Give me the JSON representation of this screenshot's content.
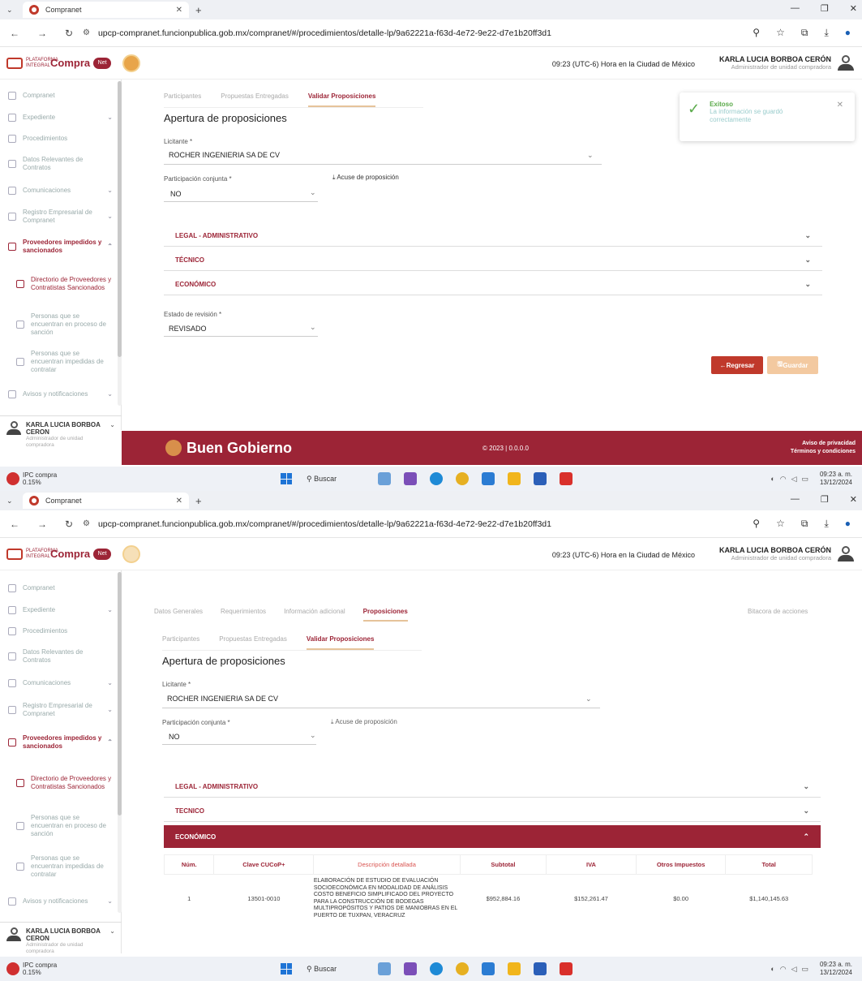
{
  "browser": {
    "tab_title_1": "Compranet",
    "tab_title_2": "Compranet",
    "url_1": "upcp-compranet.funcionpublica.gob.mx/compranet/#/procedimientos/detalle-lp/9a62221a-f63d-4e72-9e22-d7e1b20ff3d1",
    "url_2": "upcp-compranet.funcionpublica.gob.mx/compranet/#/procedimientos/detalle-lp/9a62221a-f63d-4e72-9e22-d7e1b20ff3d1"
  },
  "header": {
    "brand": "Compra",
    "brand_plus": "Net",
    "plataforma": "PLATAFORMA INTEGRAL",
    "hora": "09:23 (UTC-6) Hora en la Ciudad de México",
    "user_name": "KARLA LUCIA BORBOA CERÓN",
    "user_role": "Administrador de unidad compradora"
  },
  "sidebar": {
    "items": [
      {
        "label": "Compranet"
      },
      {
        "label": "Expediente"
      },
      {
        "label": "Procedimientos"
      },
      {
        "label": "Datos Relevantes de Contratos"
      },
      {
        "label": "Comunicaciones"
      },
      {
        "label": "Registro Empresarial de Compranet"
      },
      {
        "label": "Proveedores impedidos y sancionados"
      },
      {
        "label": "Directorio de Proveedores y Contratistas Sancionados"
      },
      {
        "label": "Personas que se encuentran en proceso de sanción"
      },
      {
        "label": "Personas que se encuentran impedidas de contratar"
      },
      {
        "label": "Avisos y notificaciones"
      }
    ],
    "user_name": "KARLA LUCIA BORBOA CERON",
    "user_role": "Administrador de unidad compradora"
  },
  "top_tabs": [
    "Datos Generales",
    "Requerimientos",
    "Información adicional",
    "Proposiciones"
  ],
  "top_tab_right": "Bitacora de acciones",
  "subtabs": [
    "Participantes",
    "Propuestas Entregadas",
    "Validar Proposiciones"
  ],
  "form": {
    "title": "Apertura de proposiciones",
    "licitante_label": "Licitante *",
    "licitante_value": "ROCHER INGENIERIA SA DE CV",
    "participacion_label": "Participación conjunta *",
    "participacion_value": "NO",
    "acuse": "Acuse de proposición",
    "acc_legal": "LEGAL - ADMINISTRATIVO",
    "acc_tecnico": "TÉCNICO",
    "acc_economico": "ECONÓMICO",
    "acc_tecnico_2": "TECNICO",
    "estado_label": "Estado de revisión *",
    "estado_value": "REVISADO",
    "btn_regresar": "Regresar",
    "btn_guardar": "Guardar"
  },
  "toast": {
    "title": "Exitoso",
    "message": "La información se guardó correctamente"
  },
  "table": {
    "headers": [
      "Núm.",
      "Clave CUCoP+",
      "Descripción detallada",
      "Subtotal",
      "IVA",
      "Otros Impuestos",
      "Total"
    ],
    "row": {
      "num": "1",
      "clave": "13501-0010",
      "desc": "ELABORACIÓN DE ESTUDIO DE EVALUACIÓN SOCIOECONÓMICA EN MODALIDAD DE ANÁLISIS COSTO BENEFICIO SIMPLIFICADO DEL PROYECTO PARA LA CONSTRUCCIÓN DE BODEGAS MULTIPROPÓSITOS Y PATIOS DE MANIOBRAS EN EL PUERTO DE TUXPAN, VERACRUZ",
      "subtotal": "$952,884.16",
      "iva": "$152,261.47",
      "otros": "$0.00",
      "total": "$1,140,145.63"
    }
  },
  "footer": {
    "brand": "Buen Gobierno",
    "copyright": "© 2023 | 0.0.0.0",
    "privacy": "Aviso de privacidad",
    "terms": "Términos y condiciones"
  },
  "taskbar": {
    "widget_title": "IPC compra",
    "widget_value": "0.15%",
    "search": "Buscar",
    "time": "09:23 a. m.",
    "date": "13/12/2024"
  }
}
